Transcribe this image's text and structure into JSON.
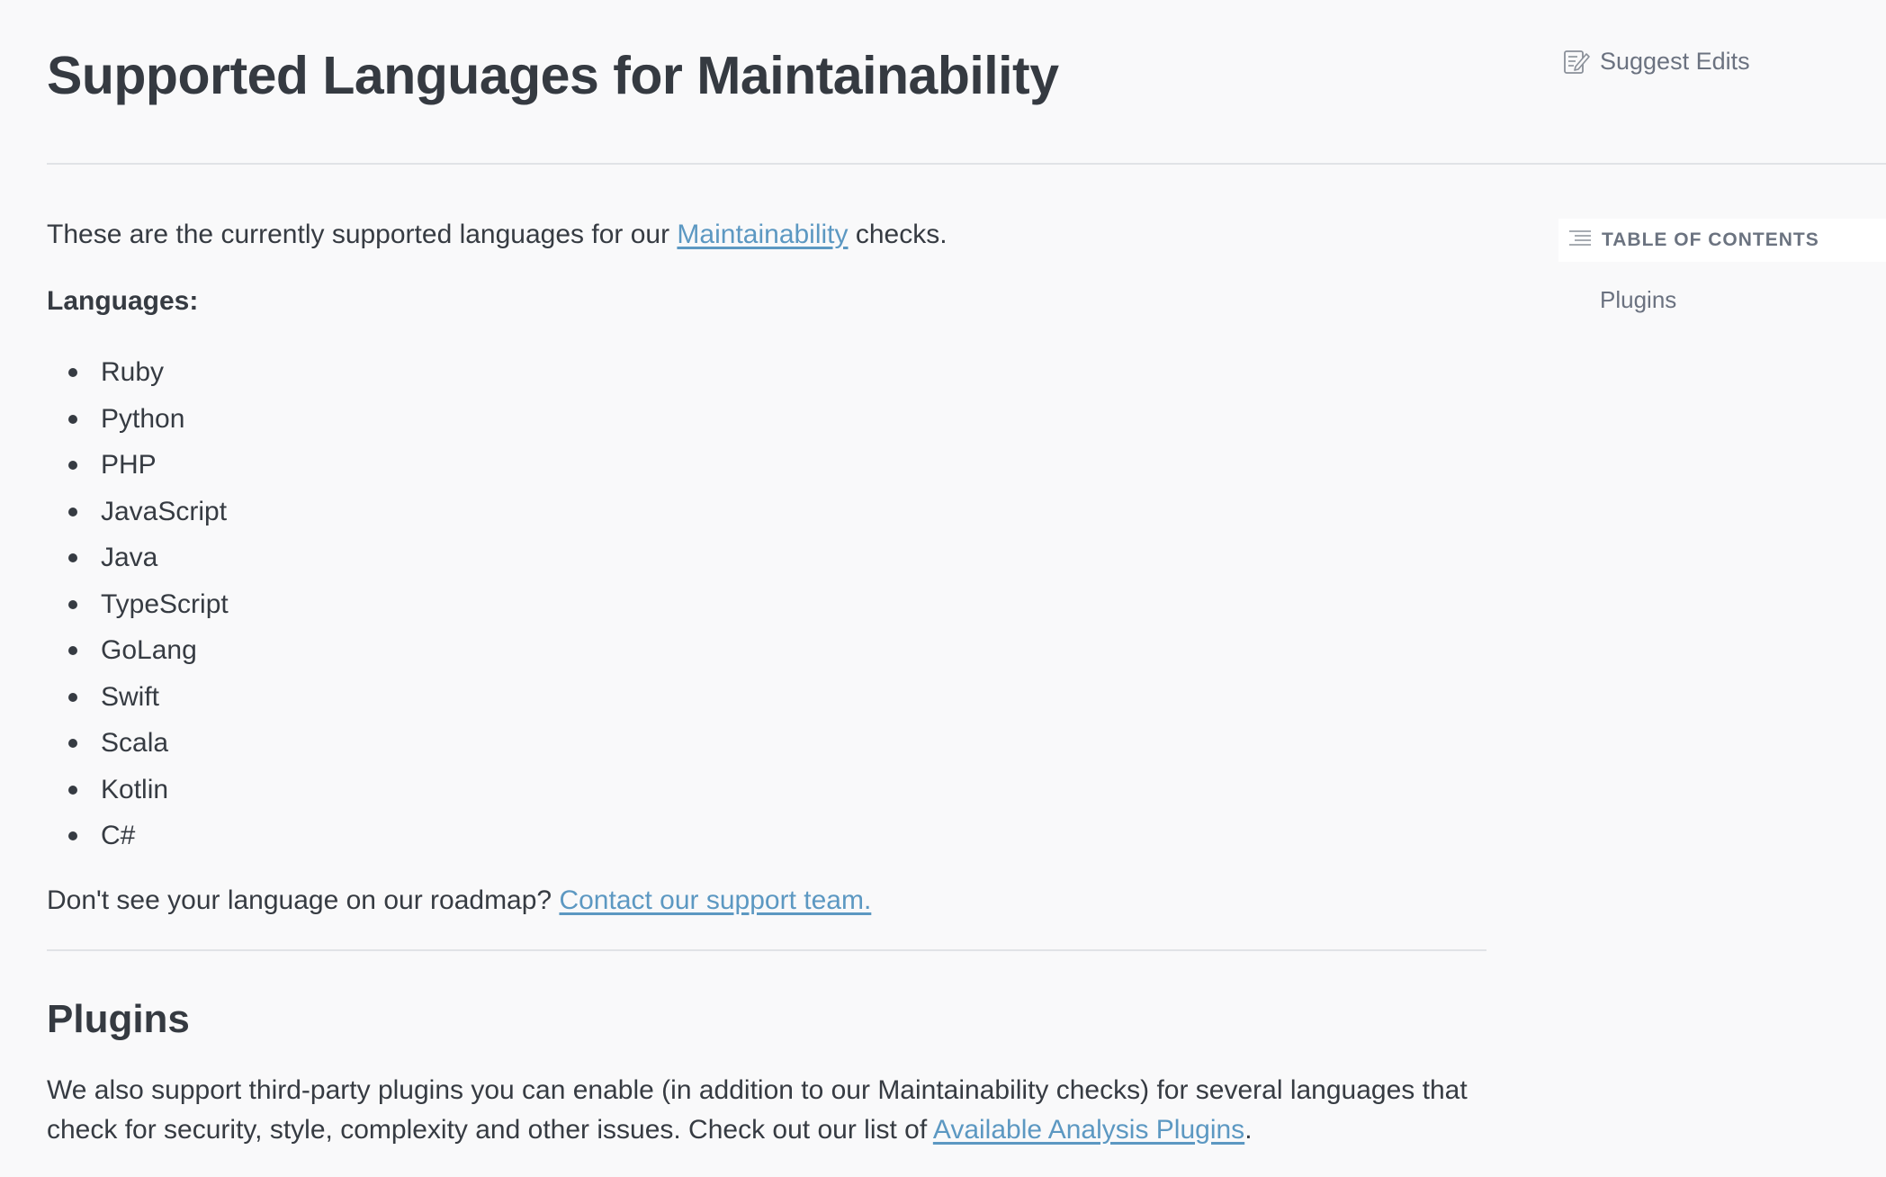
{
  "header": {
    "title": "Supported Languages for Maintainability",
    "suggest_edits_label": "Suggest Edits",
    "suggest_edits_icon": "edit-document-icon"
  },
  "main": {
    "intro": {
      "before": "These are the currently supported languages for our ",
      "link_text": "Maintainability",
      "after": " checks."
    },
    "languages_heading": "Languages:",
    "languages": [
      "Ruby",
      "Python",
      "PHP",
      "JavaScript",
      "Java",
      "TypeScript",
      "GoLang",
      "Swift",
      "Scala",
      "Kotlin",
      "C#"
    ],
    "roadmap": {
      "before": "Don't see your language on our roadmap? ",
      "link_text": "Contact our support team."
    },
    "plugins": {
      "heading": "Plugins",
      "text_before": "We also support third-party plugins you can enable (in addition to our Maintainability checks) for several languages that check for security, style, complexity and other issues. Check out our list of ",
      "link_text": "Available Analysis Plugins",
      "text_after": "."
    }
  },
  "sidebar": {
    "toc_title": "TABLE OF CONTENTS",
    "toc_icon": "list-lines-icon",
    "items": [
      {
        "label": "Plugins"
      }
    ]
  },
  "colors": {
    "link": "#5c98c2",
    "text": "#363b42",
    "muted": "#6b7280",
    "background": "#f9f9fa",
    "rule": "#e1e3e6"
  }
}
